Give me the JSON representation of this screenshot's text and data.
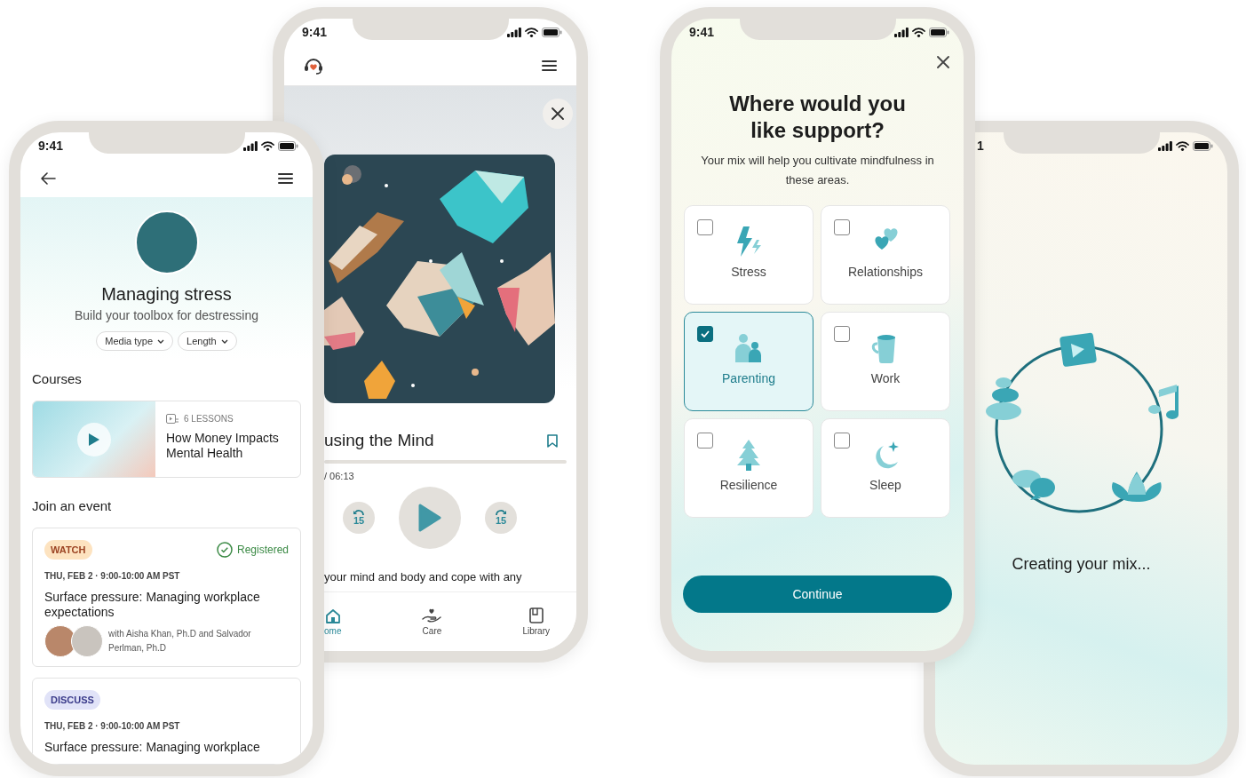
{
  "topic_screen": {
    "time": "9:41",
    "title": "Managing stress",
    "subtitle": "Build your toolbox for destressing",
    "filters": [
      "Media type",
      "Length"
    ],
    "courses_heading": "Courses",
    "course": {
      "lessons": "6 LESSONS",
      "title": "How Money Impacts Mental Health"
    },
    "events_heading": "Join an event",
    "events": [
      {
        "kind": "watch",
        "tag": "WATCH",
        "status": "Registered",
        "date": "THU, FEB 2 · 9:00-10:00 AM PST",
        "title": "Surface pressure: Managing workplace expectations",
        "hosts": "with Aisha Khan, Ph.D and Salvador Perlman, Ph.D"
      },
      {
        "kind": "discuss",
        "tag": "DISCUSS",
        "date": "THU, FEB 2 · 9:00-10:00 AM PST",
        "title": "Surface pressure: Managing workplace"
      }
    ]
  },
  "player_screen": {
    "time": "9:41",
    "title": "using the Mind",
    "elapsed": "/ 06:13",
    "skip_back": "15",
    "skip_forward": "15",
    "description": "your mind and body and cope with any",
    "nav": [
      {
        "kind": "home",
        "label": "ome",
        "selected": true
      },
      {
        "kind": "care",
        "label": "Care",
        "selected": false
      },
      {
        "kind": "library",
        "label": "Library",
        "selected": false
      }
    ]
  },
  "support_screen": {
    "time": "9:41",
    "title": "Where would you like support?",
    "subtitle": "Your mix will help you cultivate mindfulness in these areas.",
    "options": [
      {
        "kind": "stress",
        "label": "Stress",
        "checked": false
      },
      {
        "kind": "relationships",
        "label": "Relationships",
        "checked": false
      },
      {
        "kind": "parenting",
        "label": "Parenting",
        "checked": true
      },
      {
        "kind": "work",
        "label": "Work",
        "checked": false
      },
      {
        "kind": "resilience",
        "label": "Resilience",
        "checked": false
      },
      {
        "kind": "sleep",
        "label": "Sleep",
        "checked": false
      }
    ],
    "continue": "Continue"
  },
  "loading_screen": {
    "time": "1",
    "message": "Creating your mix..."
  }
}
